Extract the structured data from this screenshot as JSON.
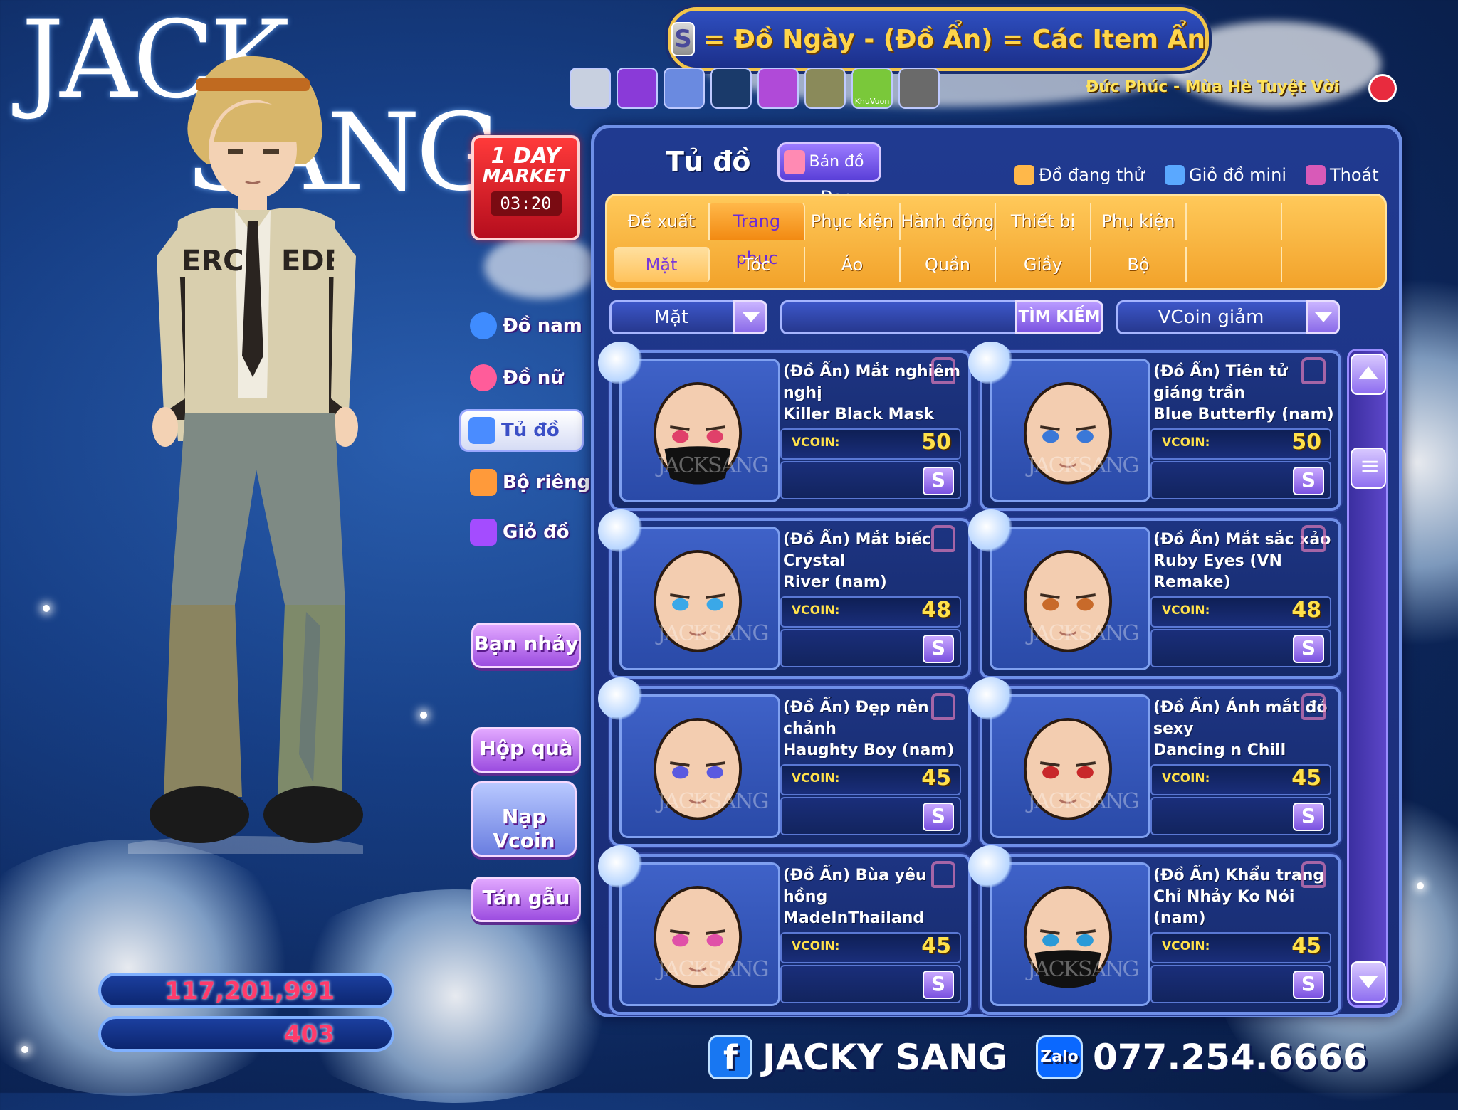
{
  "logo": {
    "line1": "JACK",
    "line2": "SANG"
  },
  "market": {
    "line1": "1 DAY",
    "line2": "MARKET",
    "timer": "03:20"
  },
  "left_menu": [
    {
      "label": "Đồ nam",
      "icon": "male-icon",
      "color": "#3f8cff"
    },
    {
      "label": "Đồ nữ",
      "icon": "female-icon",
      "color": "#ff5c9a"
    },
    {
      "label": "Tủ đồ",
      "icon": "wardrobe-icon",
      "color": "#4a8cff"
    },
    {
      "label": "Bộ riêng",
      "icon": "outfit-set-icon",
      "color": "#ff9a3a"
    },
    {
      "label": "Giỏ đồ",
      "icon": "basket-icon",
      "color": "#a44cff"
    }
  ],
  "buttons": {
    "dance_partner": "Bạn nhảy",
    "gift_box": "Hộp quà",
    "topup": "Nạp\nVcoin",
    "chat": "Tán gẫu"
  },
  "currency": {
    "gold": "117,201,991",
    "vcoin": "403"
  },
  "banner": {
    "s_icon": "S",
    "text": "= Đồ Ngày - (Đồ Ẩn) = Các Item Ẩn"
  },
  "quick_icons": [
    "ghost-icon",
    "mask-icon",
    "octopus-icon",
    "cat-icon",
    "tv-icon",
    "photo-icon",
    "garden-icon",
    "emoji-icon"
  ],
  "quick_icon_label": "KhuVuon",
  "music": {
    "now_playing": "Đức Phúc - Mùa Hè Tuyệt Vời"
  },
  "panel": {
    "title": "Tủ đồ",
    "ban_do_den": "Bán đồ Đen",
    "links": {
      "trying": "Đồ đang thử",
      "mini_cart": "Giỏ đồ mini",
      "exit": "Thoát"
    }
  },
  "tabs": {
    "row1": [
      "Đề xuất",
      "Trang phục",
      "Phục kiện",
      "Hành động",
      "Thiết bị",
      "Phụ kiện",
      "",
      ""
    ],
    "row1_active": 1,
    "row2": [
      "Mặt",
      "Tóc",
      "Áo",
      "Quần",
      "Giầy",
      "Bộ",
      "",
      ""
    ],
    "row2_active": 0
  },
  "filters": {
    "category": "Mặt",
    "search_value": "",
    "search_label": "TÌM KIẾM",
    "sort": "VCoin giảm"
  },
  "items": [
    {
      "name": "(Đồ Ẩn) Mắt nghiêm nghị\nKiller Black Mask\n(Nam)",
      "price_label": "VCOIN:",
      "price": "50",
      "buy": "S",
      "face": "mask",
      "eye": "#e0406a"
    },
    {
      "name": "(Đồ Ẩn) Tiên tử\ngiáng trần\nBlue Butterfly (nam)",
      "price_label": "VCOIN:",
      "price": "50",
      "buy": "S",
      "face": "plain",
      "eye": "#3a78d8"
    },
    {
      "name": "(Đồ Ẩn) Mắt biếc Crystal\nRiver (nam)",
      "price_label": "VCOIN:",
      "price": "48",
      "buy": "S",
      "face": "plain",
      "eye": "#3aa8e8"
    },
    {
      "name": "(Đồ Ẩn) Mắt sắc xảo\nRuby Eyes (VN Remake)\n(nam)",
      "price_label": "VCOIN:",
      "price": "48",
      "buy": "S",
      "face": "plain",
      "eye": "#c86a2a"
    },
    {
      "name": "(Đồ Ẩn) Đẹp nên chảnh\nHaughty Boy (nam)",
      "price_label": "VCOIN:",
      "price": "45",
      "buy": "S",
      "face": "plain",
      "eye": "#5a5ae0"
    },
    {
      "name": "(Đồ Ẩn) Ánh mắt đỏ sexy\nDancing n Chill\n(VN Design)",
      "price_label": "VCOIN:",
      "price": "45",
      "buy": "S",
      "face": "plain",
      "eye": "#c8282a"
    },
    {
      "name": "(Đồ Ẩn) Bùa yêu hồng\nMadeInThailand (nam)",
      "price_label": "VCOIN:",
      "price": "45",
      "buy": "S",
      "face": "plain",
      "eye": "#e050a8"
    },
    {
      "name": "(Đồ Ẩn) Khẩu trang\nChỉ Nhảy Ko Nói\n(nam)",
      "price_label": "VCOIN:",
      "price": "45",
      "buy": "S",
      "face": "mask",
      "eye": "#2a9ad8"
    }
  ],
  "card_watermark": "JACKSANG",
  "footer": {
    "facebook_icon": "f",
    "facebook_name": "JACKY SANG",
    "zalo_icon": "Zalo",
    "phone": "077.254.6666"
  }
}
